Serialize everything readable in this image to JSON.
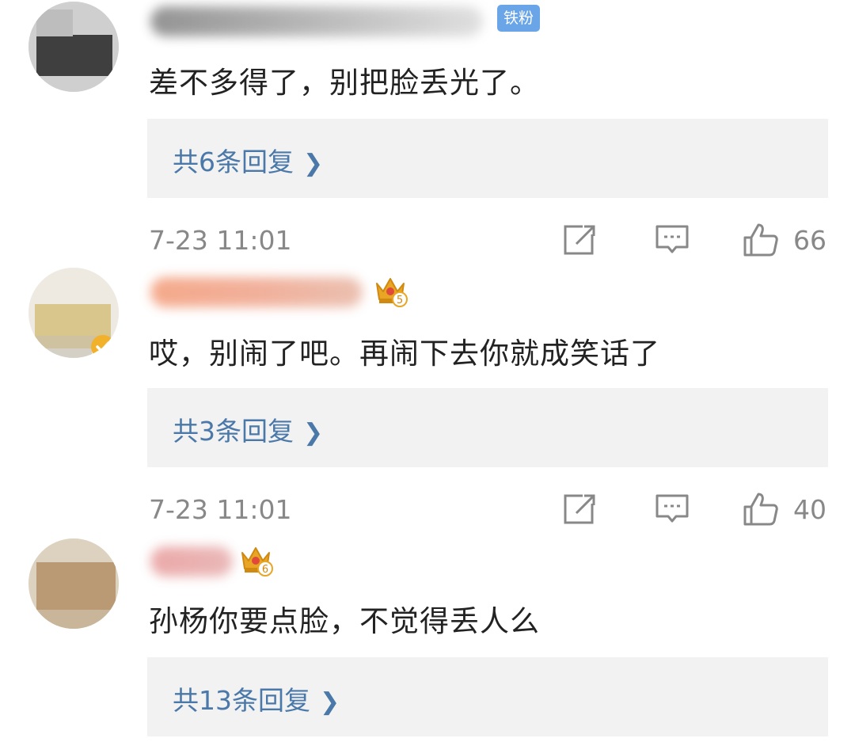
{
  "comments": [
    {
      "badge": "铁粉",
      "text": "差不多得了，别把脸丢光了。",
      "replies": "共6条回复",
      "time": "7-23 11:01",
      "likes": "66"
    },
    {
      "crown_level": "5",
      "text": "哎，别闹了吧。再闹下去你就成笑话了",
      "replies": "共3条回复",
      "time": "7-23 11:01",
      "likes": "40"
    },
    {
      "crown_level": "6",
      "text": "孙杨你要点脸，不觉得丢人么",
      "replies": "共13条回复"
    }
  ],
  "icons": {
    "share": "share-icon",
    "comment": "comment-icon",
    "like": "thumbs-up-icon",
    "chevron": "chevron-right-icon",
    "crown": "crown-icon"
  },
  "colors": {
    "link": "#4a78a8",
    "meta": "#888888",
    "reply_bg": "#f2f2f2",
    "fan_badge": "#6aa5e8",
    "crown": "#e8a624"
  }
}
